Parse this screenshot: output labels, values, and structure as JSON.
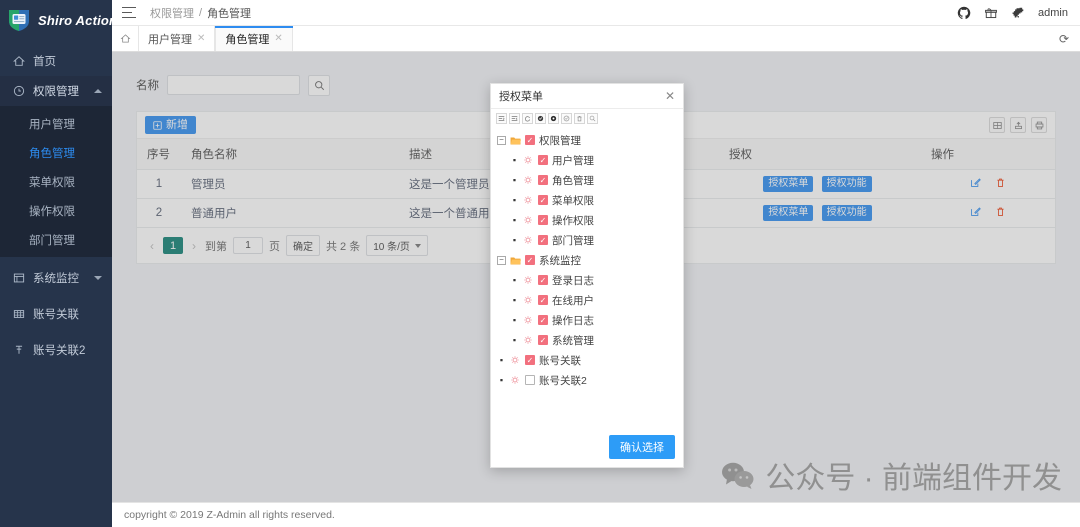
{
  "app": {
    "brand": "Shiro Action",
    "user": "admin"
  },
  "header": {
    "breadcrumb": [
      "权限管理",
      "角色管理"
    ],
    "separator": "/",
    "icons": [
      "github-icon",
      "gift-icon",
      "dinosaur-icon"
    ]
  },
  "tabs": {
    "items": [
      {
        "label": "用户管理",
        "active": false
      },
      {
        "label": "角色管理",
        "active": true
      }
    ],
    "close_glyph": "✕",
    "refresh_glyph": "⟳"
  },
  "sidebar": {
    "items": [
      {
        "label": "首页",
        "icon": "home-icon",
        "type": "link"
      },
      {
        "label": "权限管理",
        "icon": "shield-icon",
        "type": "group",
        "expanded": true,
        "arrow": "up"
      },
      {
        "label": "系统监控",
        "icon": "monitor-icon",
        "type": "group",
        "expanded": false,
        "arrow": "down"
      },
      {
        "label": "账号关联",
        "icon": "table-icon",
        "type": "link"
      },
      {
        "label": "账号关联2",
        "icon": "pin-icon",
        "type": "link"
      }
    ],
    "submenu": [
      {
        "label": "用户管理",
        "active": false
      },
      {
        "label": "角色管理",
        "active": true
      },
      {
        "label": "菜单权限",
        "active": false
      },
      {
        "label": "操作权限",
        "active": false
      },
      {
        "label": "部门管理",
        "active": false
      }
    ]
  },
  "search": {
    "label": "名称",
    "value": "",
    "placeholder": "",
    "button_icon": "search-icon"
  },
  "toolbar": {
    "add_label": "新增",
    "add_icon": "plus-square-icon",
    "right_icons": [
      "columns-icon",
      "export-icon",
      "print-icon"
    ]
  },
  "table": {
    "columns": [
      "序号",
      "角色名称",
      "描述",
      "授权",
      "操作"
    ],
    "rows": [
      {
        "index": "1",
        "name": "管理员",
        "desc": "这是一个管理员",
        "auth_buttons": [
          "授权菜单",
          "授权功能"
        ],
        "op_icons": [
          "edit-icon",
          "delete-icon"
        ]
      },
      {
        "index": "2",
        "name": "普通用户",
        "desc": "这是一个普通用户",
        "auth_buttons": [
          "授权菜单",
          "授权功能"
        ],
        "op_icons": [
          "edit-icon",
          "delete-icon"
        ]
      }
    ]
  },
  "pagination": {
    "prev": "‹",
    "next": "›",
    "current_page": "1",
    "goto_prefix": "到第",
    "goto_value": "1",
    "goto_suffix": "页",
    "confirm": "确定",
    "total_text": "共 2 条",
    "page_size": "10 条/页"
  },
  "modal": {
    "title": "授权菜单",
    "close_glyph": "✕",
    "toolbar_icons": [
      "expand-all-icon",
      "collapse-all-icon",
      "refresh-icon",
      "check-filled-icon",
      "check-dark-icon",
      "check-circle-icon",
      "trash-icon",
      "zoom-icon"
    ],
    "tree": [
      {
        "label": "权限管理",
        "level": 1,
        "type": "folder",
        "expanded": true,
        "checked": true
      },
      {
        "label": "用户管理",
        "level": 2,
        "type": "leaf",
        "checked": true
      },
      {
        "label": "角色管理",
        "level": 2,
        "type": "leaf",
        "checked": true
      },
      {
        "label": "菜单权限",
        "level": 2,
        "type": "leaf",
        "checked": true
      },
      {
        "label": "操作权限",
        "level": 2,
        "type": "leaf",
        "checked": true
      },
      {
        "label": "部门管理",
        "level": 2,
        "type": "leaf",
        "checked": true
      },
      {
        "label": "系统监控",
        "level": 1,
        "type": "folder",
        "expanded": true,
        "checked": true
      },
      {
        "label": "登录日志",
        "level": 2,
        "type": "leaf",
        "checked": true
      },
      {
        "label": "在线用户",
        "level": 2,
        "type": "leaf",
        "checked": true
      },
      {
        "label": "操作日志",
        "level": 2,
        "type": "leaf",
        "checked": true
      },
      {
        "label": "系统管理",
        "level": 2,
        "type": "leaf",
        "checked": true
      },
      {
        "label": "账号关联",
        "level": 1,
        "type": "leaf",
        "checked": true
      },
      {
        "label": "账号关联2",
        "level": 1,
        "type": "leaf",
        "checked": false
      }
    ],
    "confirm_label": "确认选择"
  },
  "footer": {
    "copyright": "copyright © 2019 Z-Admin all rights reserved."
  },
  "watermark": {
    "text": "公众号 · 前端组件开发",
    "icon": "wechat-icon"
  },
  "colors": {
    "sidebar_bg": "#26344b",
    "submenu_bg": "#1d2636",
    "accent_blue": "#2d8cf0",
    "page_bg": "#f0f2f5",
    "pager_active": "#0f8074",
    "checkbox_red": "#f2707e",
    "folder_orange": "#f0a739"
  }
}
